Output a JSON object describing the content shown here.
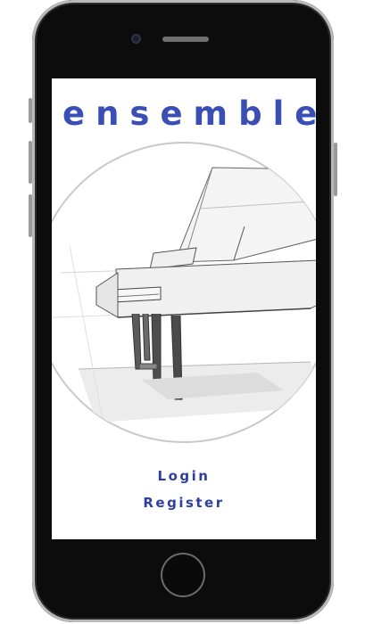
{
  "app": {
    "title": "ensemble"
  },
  "illustration": {
    "subject": "grand piano pencil sketch"
  },
  "nav": {
    "login_label": "Login",
    "register_label": "Register"
  },
  "colors": {
    "brand": "#3a4fb6",
    "link": "#2f3f9d",
    "device": "#0c0c0c"
  },
  "icons": {
    "home_button": "home-button",
    "camera": "front-camera"
  }
}
